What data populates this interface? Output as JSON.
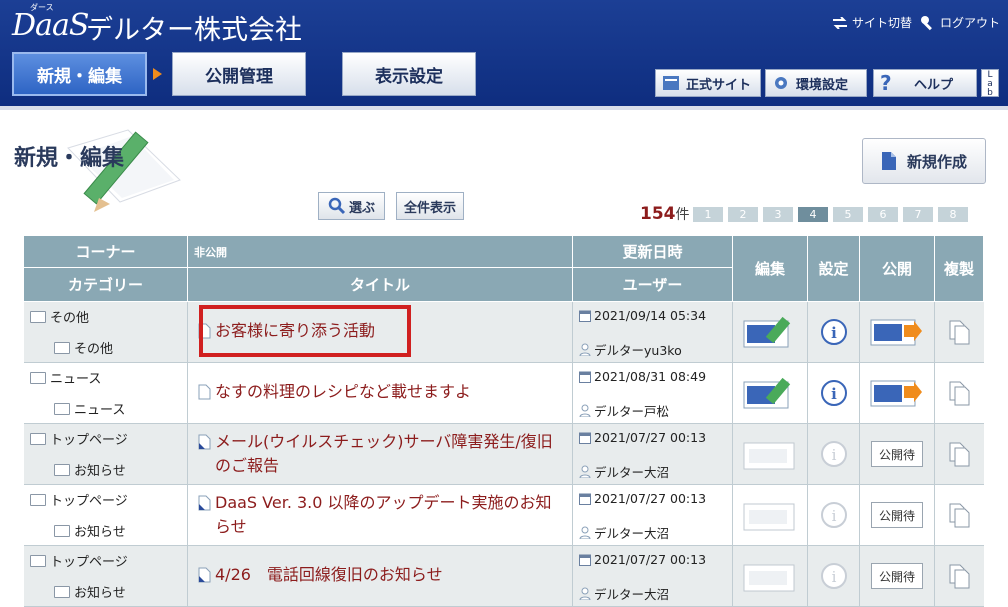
{
  "header": {
    "logo": "DaaS",
    "logo_ruby": "ダース",
    "company": "デルター株式会社",
    "site_switch": "サイト切替",
    "logout": "ログアウト",
    "tabs": [
      "新規・編集",
      "公開管理",
      "表示設定"
    ],
    "buttons": {
      "official_site": "正式サイト",
      "env_settings": "環境設定",
      "help": "ヘルプ",
      "lab": "Lab"
    }
  },
  "page": {
    "title": "新規・編集",
    "new_button": "新規作成",
    "select_button": "選ぶ",
    "show_all_button": "全件表示",
    "count": "154",
    "count_unit": "件",
    "pages": [
      "1",
      "2",
      "3",
      "4",
      "5",
      "6",
      "7",
      "8"
    ],
    "current_page": "4"
  },
  "table": {
    "headers": {
      "corner": "コーナー",
      "category": "カテゴリー",
      "private": "非公開",
      "title": "タイトル",
      "updated": "更新日時",
      "user": "ユーザー",
      "edit": "編集",
      "settings": "設定",
      "publish": "公開",
      "copy": "複製"
    },
    "rows": [
      {
        "corner": "その他",
        "category": "その他",
        "title": "お客様に寄り添う活動",
        "date": "2021/09/14 05:34",
        "user": "デルターyu3ko",
        "pending": ""
      },
      {
        "corner": "ニュース",
        "category": "ニュース",
        "title": "なすの料理のレシピなど載せますよ",
        "date": "2021/08/31 08:49",
        "user": "デルター戸松",
        "pending": ""
      },
      {
        "corner": "トップページ",
        "category": "お知らせ",
        "title": "メール(ウイルスチェック)サーバ障害発生/復旧のご報告",
        "date": "2021/07/27 00:13",
        "user": "デルター大沼",
        "pending": "公開待"
      },
      {
        "corner": "トップページ",
        "category": "お知らせ",
        "title": "DaaS Ver. 3.0 以降のアップデート実施のお知らせ",
        "date": "2021/07/27 00:13",
        "user": "デルター大沼",
        "pending": "公開待"
      },
      {
        "corner": "トップページ",
        "category": "お知らせ",
        "title": "4/26　電話回線復旧のお知らせ",
        "date": "2021/07/27 00:13",
        "user": "デルター大沼",
        "pending": "公開待"
      }
    ]
  }
}
